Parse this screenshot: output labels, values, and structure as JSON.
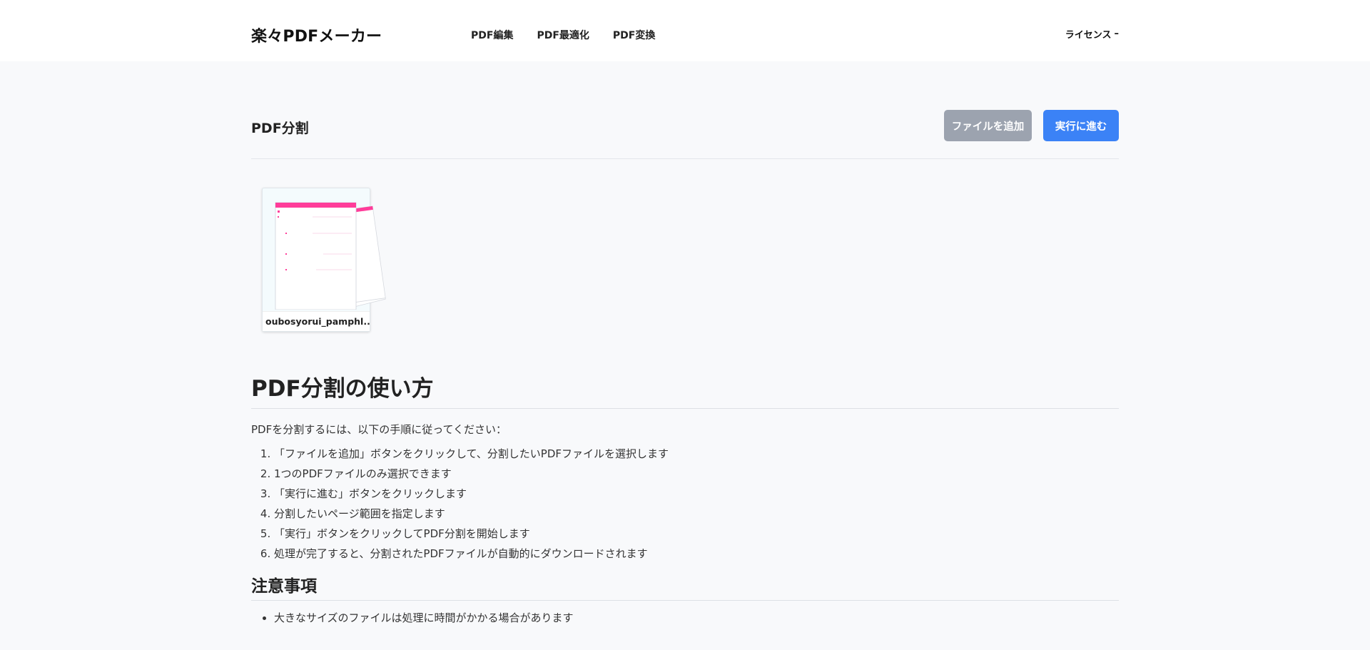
{
  "header": {
    "logo": "楽々PDFメーカー",
    "nav": [
      "PDF編集",
      "PDF最適化",
      "PDF変換"
    ],
    "license": "ライセンス",
    "license_icon": "dash-icon"
  },
  "toolbar": {
    "title": "PDF分割",
    "add_file_label": "ファイルを追加",
    "proceed_label": "実行に進む"
  },
  "file": {
    "name": "oubosyorui_pamphl..."
  },
  "howto": {
    "title": "PDF分割の使い方",
    "intro": "PDFを分割するには、以下の手順に従ってください：",
    "steps": [
      "「ファイルを追加」ボタンをクリックして、分割したいPDFファイルを選択します",
      "1つのPDFファイルのみ選択できます",
      "「実行に進む」ボタンをクリックします",
      "分割したいページ範囲を指定します",
      "「実行」ボタンをクリックしてPDF分割を開始します",
      "処理が完了すると、分割されたPDFファイルが自動的にダウンロードされます"
    ]
  },
  "notes": {
    "title": "注意事項",
    "items": [
      "大きなサイズのファイルは処理に時間がかかる場合があります"
    ]
  },
  "colors": {
    "primary": "#3b82f6",
    "disabled": "#9ca3af",
    "background": "#f8f9fb",
    "thumb_accent": "#ff3d9a"
  }
}
